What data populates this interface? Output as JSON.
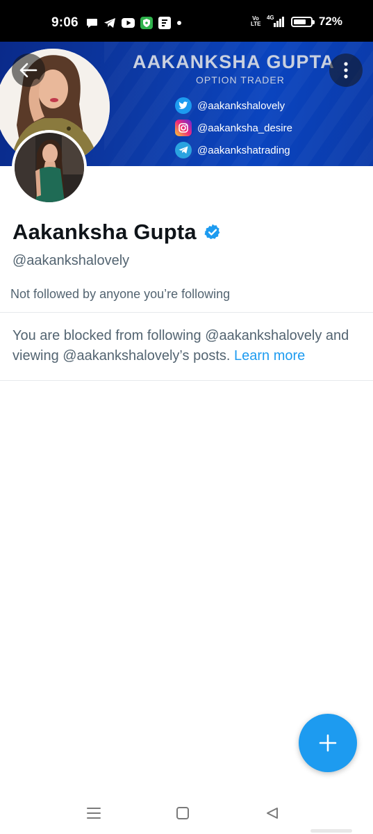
{
  "status_bar": {
    "time": "9:06",
    "network_label": "Vo LTE",
    "network_type": "4G",
    "battery_percent": 72,
    "battery_text": "72%",
    "notification_icons": [
      "chat-bubble-icon",
      "telegram-icon",
      "youtube-icon",
      "shield-app-icon",
      "media-app-icon",
      "dot-icon"
    ]
  },
  "banner": {
    "name": "AAKANKSHA GUPTA",
    "subtitle": "OPTION TRADER",
    "socials": [
      {
        "platform": "twitter",
        "handle": "@aakankshalovely",
        "color": "#1d9bf0"
      },
      {
        "platform": "instagram",
        "handle": "@aakanksha_desire",
        "color": "#d6249f"
      },
      {
        "platform": "telegram",
        "handle": "@aakankshatrading",
        "color": "#2aa3e0"
      }
    ]
  },
  "profile": {
    "display_name": "Aakanksha Gupta",
    "verified": true,
    "handle": "@aakankshalovely",
    "followers_note": "Not followed by anyone you’re following"
  },
  "blocked_notice": {
    "text": "You are blocked from following @aakankshalovely and viewing @aakankshalovely’s posts.",
    "link_label": "Learn more"
  },
  "colors": {
    "accent": "#1d9bf0",
    "secondary_text": "#536471",
    "primary_text": "#0f1419",
    "banner_blue": "#0c3aa6"
  },
  "system_nav": [
    "menu-icon",
    "home-square-icon",
    "back-triangle-icon"
  ]
}
